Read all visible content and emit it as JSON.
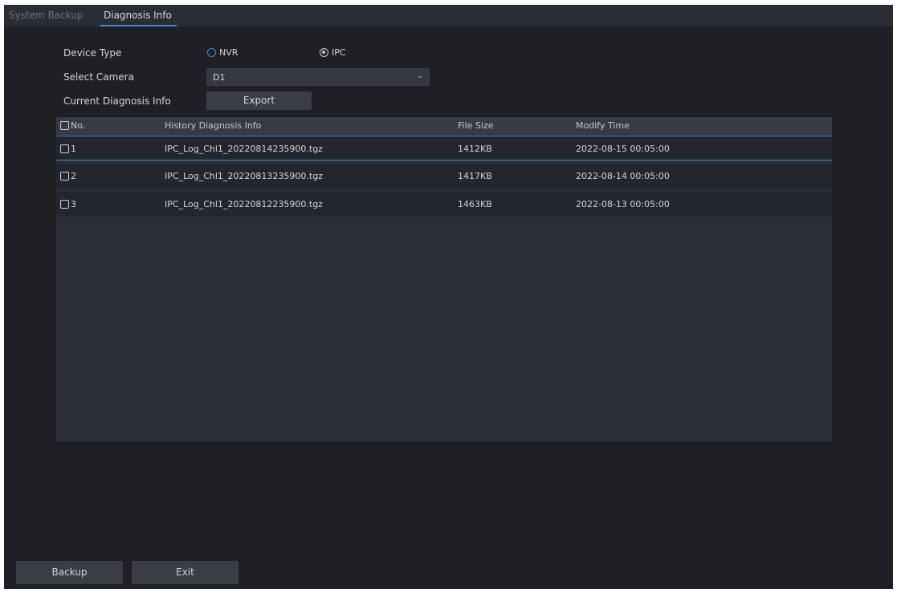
{
  "tabs": [
    {
      "label": "System Backup",
      "active": false
    },
    {
      "label": "Diagnosis Info",
      "active": true
    }
  ],
  "form": {
    "device_type_label": "Device Type",
    "device_type_options": [
      {
        "label": "NVR",
        "checked": false
      },
      {
        "label": "IPC",
        "checked": true
      }
    ],
    "select_camera_label": "Select Camera",
    "select_camera_value": "D1",
    "current_diag_label": "Current Diagnosis Info",
    "export_label": "Export"
  },
  "table": {
    "columns": [
      "No.",
      "History Diagnosis Info",
      "File Size",
      "Modify Time"
    ],
    "rows": [
      {
        "no": "1",
        "name": "IPC_Log_Chl1_20220814235900.tgz",
        "size": "1412KB",
        "time": "2022-08-15 00:05:00",
        "selected": true
      },
      {
        "no": "2",
        "name": "IPC_Log_Chl1_20220813235900.tgz",
        "size": "1417KB",
        "time": "2022-08-14 00:05:00",
        "selected": false
      },
      {
        "no": "3",
        "name": "IPC_Log_Chl1_20220812235900.tgz",
        "size": "1463KB",
        "time": "2022-08-13 00:05:00",
        "selected": false
      }
    ]
  },
  "footer": {
    "backup_label": "Backup",
    "exit_label": "Exit"
  },
  "colors": {
    "accent": "#3d8fd8",
    "background": "#1e2025",
    "table_bg": "#2c2f39",
    "button_bg": "#3a3d44"
  }
}
